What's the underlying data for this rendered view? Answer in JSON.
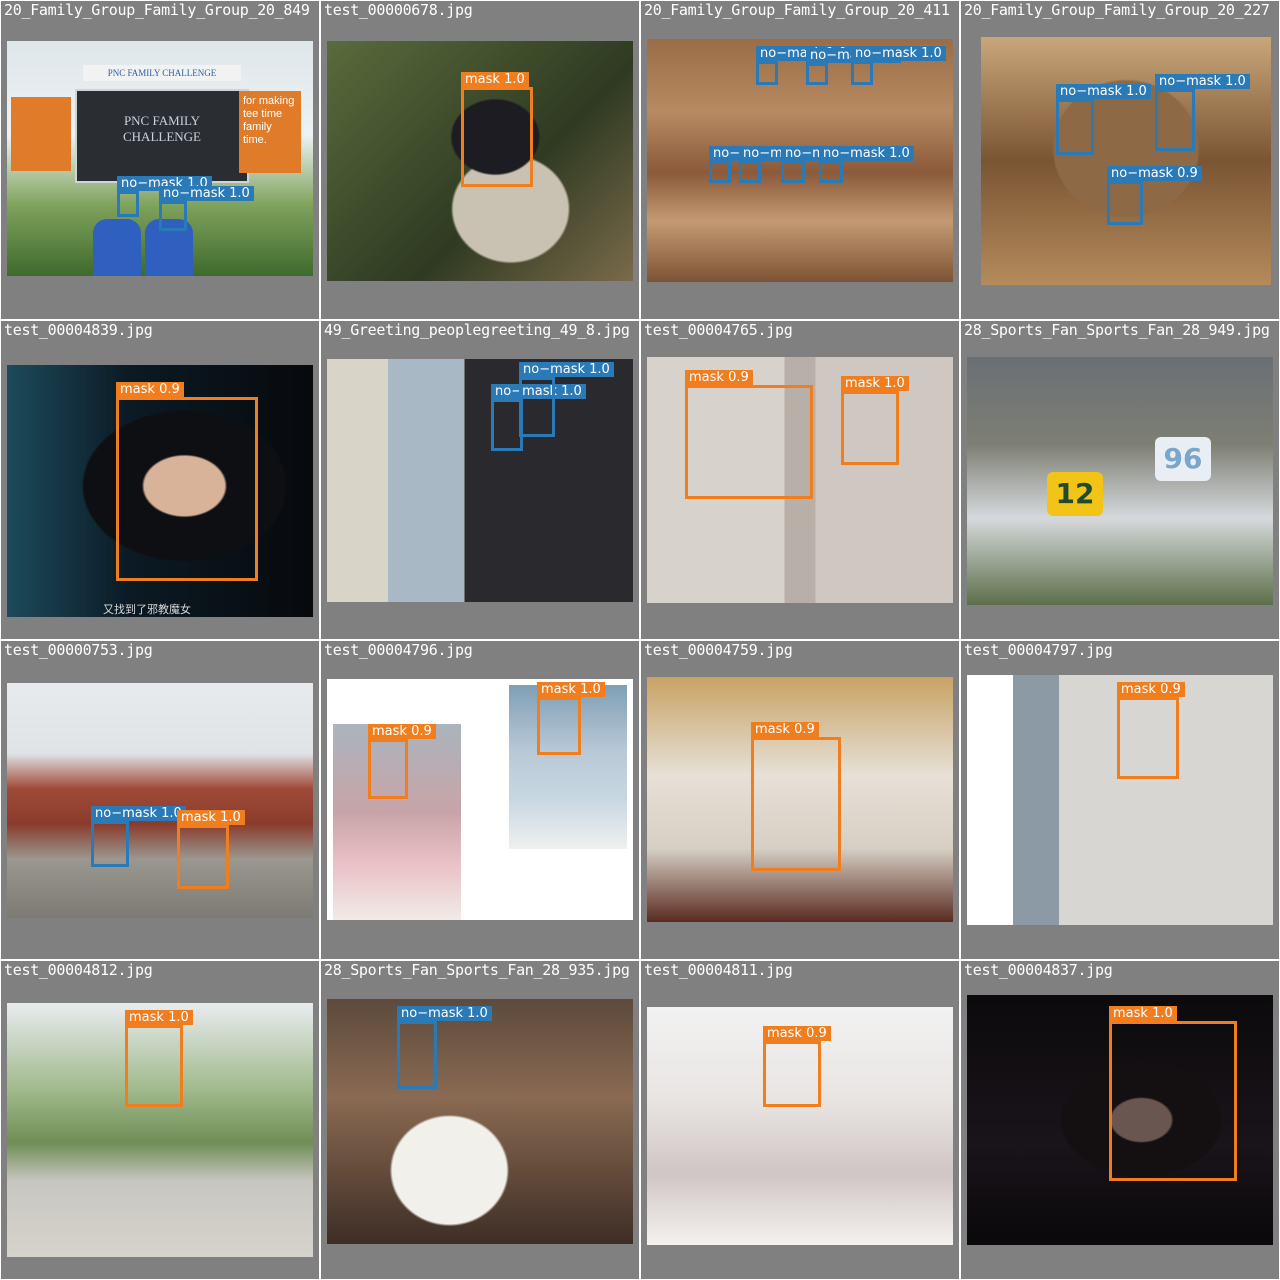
{
  "colors": {
    "mask": "#f07d1e",
    "no_mask": "#2b7ab8",
    "tile_background": "#808080"
  },
  "tiles": [
    {
      "filename": "20_Family_Group_Family_Group_20_849",
      "detections": [
        {
          "label": "no−mask 1.0",
          "class": "no-mask"
        },
        {
          "label": "no−mask 1.0",
          "class": "no-mask"
        }
      ],
      "sign": {
        "brand": "PNC FAMILY CHALLENGE",
        "screen": "PNC FAMILY CHALLENGE",
        "side": "for making tee time family time."
      }
    },
    {
      "filename": "test_00000678.jpg",
      "detections": [
        {
          "label": "mask 1.0",
          "class": "mask"
        }
      ]
    },
    {
      "filename": "20_Family_Group_Family_Group_20_411",
      "detections": [
        {
          "label": "no−mask 1.0",
          "class": "no-mask"
        },
        {
          "label": "no−mask 1.0",
          "class": "no-mask"
        },
        {
          "label": "no−mask 1.0",
          "class": "no-mask"
        },
        {
          "label": "no−mask 1.0",
          "class": "no-mask"
        },
        {
          "label": "no−mask 1.0",
          "class": "no-mask"
        },
        {
          "label": "no−mask 1.0",
          "class": "no-mask"
        },
        {
          "label": "no−mask 1.0",
          "class": "no-mask"
        }
      ]
    },
    {
      "filename": "20_Family_Group_Family_Group_20_227",
      "detections": [
        {
          "label": "no−mask 1.0",
          "class": "no-mask"
        },
        {
          "label": "no−mask 1.0",
          "class": "no-mask"
        },
        {
          "label": "no−mask 0.9",
          "class": "no-mask"
        }
      ]
    },
    {
      "filename": "test_00004839.jpg",
      "detections": [
        {
          "label": "mask 0.9",
          "class": "mask"
        }
      ],
      "subtitle": "又找到了邪教魔女"
    },
    {
      "filename": "49_Greeting_peoplegreeting_49_8.jpg",
      "detections": [
        {
          "label": "no−mask 1.0",
          "class": "no-mask"
        },
        {
          "label": "no−mask 1.0",
          "class": "no-mask"
        }
      ]
    },
    {
      "filename": "test_00004765.jpg",
      "detections": [
        {
          "label": "mask 0.9",
          "class": "mask"
        },
        {
          "label": "mask 1.0",
          "class": "mask"
        }
      ]
    },
    {
      "filename": "28_Sports_Fan_Sports_Fan_28_949.jpg",
      "detections": [],
      "jersey_numbers": [
        "12",
        "96"
      ]
    },
    {
      "filename": "test_00000753.jpg",
      "detections": [
        {
          "label": "no−mask 1.0",
          "class": "no-mask"
        },
        {
          "label": "mask 1.0",
          "class": "mask"
        }
      ]
    },
    {
      "filename": "test_00004796.jpg",
      "detections": [
        {
          "label": "mask 0.9",
          "class": "mask"
        },
        {
          "label": "mask 1.0",
          "class": "mask"
        }
      ]
    },
    {
      "filename": "test_00004759.jpg",
      "detections": [
        {
          "label": "mask 0.9",
          "class": "mask"
        }
      ]
    },
    {
      "filename": "test_00004797.jpg",
      "detections": [
        {
          "label": "mask 0.9",
          "class": "mask"
        }
      ]
    },
    {
      "filename": "test_00004812.jpg",
      "detections": [
        {
          "label": "mask 1.0",
          "class": "mask"
        }
      ]
    },
    {
      "filename": "28_Sports_Fan_Sports_Fan_28_935.jpg",
      "detections": [
        {
          "label": "no−mask 1.0",
          "class": "no-mask"
        }
      ]
    },
    {
      "filename": "test_00004811.jpg",
      "detections": [
        {
          "label": "mask 0.9",
          "class": "mask"
        }
      ]
    },
    {
      "filename": "test_00004837.jpg",
      "detections": [
        {
          "label": "mask 1.0",
          "class": "mask"
        }
      ]
    }
  ]
}
